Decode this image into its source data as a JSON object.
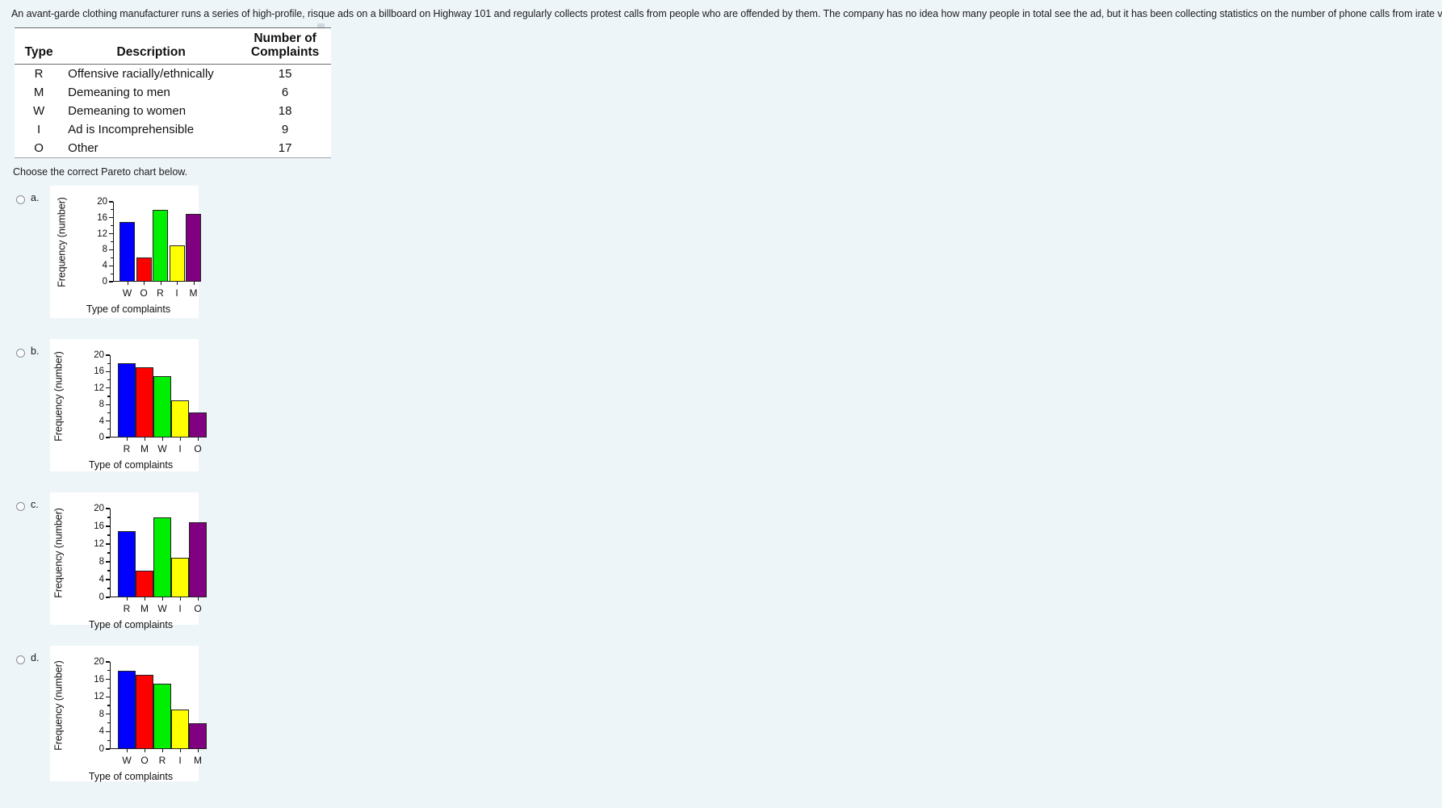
{
  "prompt": "An avant-garde clothing manufacturer runs a series of high-profile, risque ads on a billboard on Highway 101 and regularly collects protest calls from people who are offended by them. The company has no idea how many people in total see the ad, but it has been collecting statistics on the number of phone calls from irate viewers:",
  "table": {
    "headers": [
      "Type",
      "Description",
      "Number of Complaints"
    ],
    "header_num_line1": "Number of",
    "header_num_line2": "Complaints",
    "rows": [
      {
        "type": "R",
        "description": "Offensive racially/ethnically",
        "complaints": "15"
      },
      {
        "type": "M",
        "description": "Demeaning to men",
        "complaints": "6"
      },
      {
        "type": "W",
        "description": "Demeaning to women",
        "complaints": "18"
      },
      {
        "type": "I",
        "description": "Ad is Incomprehensible",
        "complaints": "9"
      },
      {
        "type": "O",
        "description": "Other",
        "complaints": "17"
      }
    ]
  },
  "instruction": "Choose the correct Pareto chart below.",
  "options": [
    {
      "letter": "a."
    },
    {
      "letter": "b."
    },
    {
      "letter": "c."
    },
    {
      "letter": "d."
    }
  ],
  "colors": {
    "bar1": "#0000ff",
    "bar2": "#ff0000",
    "bar3": "#00ee00",
    "bar4": "#ffff00",
    "bar5": "#800080",
    "page_background": "#eef5f9",
    "panel_background": "#ffffff",
    "axis": "#111111"
  },
  "chart_data": [
    {
      "id": "a",
      "type": "bar",
      "title": "",
      "xlabel": "Type of complaints",
      "ylabel": "Frequency (number)",
      "categories": [
        "W",
        "O",
        "R",
        "I",
        "M"
      ],
      "values": [
        15,
        6,
        18,
        9,
        17
      ],
      "bar_colors": [
        "#0000ff",
        "#ff0000",
        "#00ee00",
        "#ffff00",
        "#800080"
      ],
      "ylim": [
        0,
        20
      ],
      "yticks": [
        0,
        4,
        8,
        12,
        16,
        20
      ],
      "ytick_labels": [
        "0",
        "4",
        "8",
        "12",
        "16",
        "20"
      ],
      "grid": false,
      "legend": "none"
    },
    {
      "id": "b",
      "type": "bar",
      "title": "",
      "xlabel": "Type of complaints",
      "ylabel": "Frequency (number)",
      "categories": [
        "R",
        "M",
        "W",
        "I",
        "O"
      ],
      "values": [
        18,
        17,
        15,
        9,
        6
      ],
      "bar_colors": [
        "#0000ff",
        "#ff0000",
        "#00ee00",
        "#ffff00",
        "#800080"
      ],
      "ylim": [
        0,
        20
      ],
      "yticks": [
        0,
        4,
        8,
        12,
        16,
        20
      ],
      "ytick_labels": [
        "0",
        "4",
        "8",
        "12",
        "16",
        "20"
      ],
      "grid": false,
      "legend": "none"
    },
    {
      "id": "c",
      "type": "bar",
      "title": "",
      "xlabel": "Type of complaints",
      "ylabel": "Frequency (number)",
      "categories": [
        "R",
        "M",
        "W",
        "I",
        "O"
      ],
      "values": [
        15,
        6,
        18,
        9,
        17
      ],
      "bar_colors": [
        "#0000ff",
        "#ff0000",
        "#00ee00",
        "#ffff00",
        "#800080"
      ],
      "ylim": [
        0,
        20
      ],
      "yticks": [
        0,
        4,
        8,
        12,
        16,
        20
      ],
      "ytick_labels": [
        "0",
        "4",
        "8",
        "12",
        "16",
        "20"
      ],
      "grid": false,
      "legend": "none"
    },
    {
      "id": "d",
      "type": "bar",
      "title": "",
      "xlabel": "Type of complaints",
      "ylabel": "Frequency (number)",
      "categories": [
        "W",
        "O",
        "R",
        "I",
        "M"
      ],
      "values": [
        18,
        17,
        15,
        9,
        6
      ],
      "bar_colors": [
        "#0000ff",
        "#ff0000",
        "#00ee00",
        "#ffff00",
        "#800080"
      ],
      "ylim": [
        0,
        20
      ],
      "yticks": [
        0,
        4,
        8,
        12,
        16,
        20
      ],
      "ytick_labels": [
        "0",
        "4",
        "8",
        "12",
        "16",
        "20"
      ],
      "grid": false,
      "legend": "none"
    }
  ]
}
